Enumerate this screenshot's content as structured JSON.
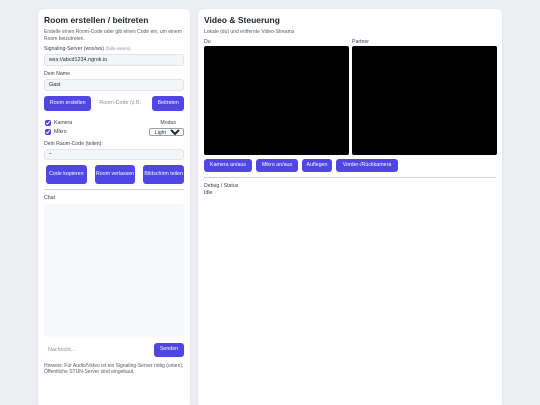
{
  "left": {
    "title": "Room erstellen / beitreten",
    "intro": "Erstelle einen Room-Code oder gib einen Code ein, um einem Room beizutreten.",
    "signaling_label": "Signaling-Server (wss/ws)",
    "signaling_hint": "(falls extern)",
    "signaling_value": "wss://abcd1234.ngrok.io",
    "name_label": "Dein Name",
    "name_value": "Gast",
    "create_room_button": "Room erstellen",
    "room_code_placeholder": "Room-Code (z.B.",
    "join_button": "Beitreten",
    "camera_label": "Kamera",
    "mic_label": "Mikro",
    "mode_label": "Modus",
    "mode_value": "Light",
    "your_code_label": "Dein Raum-Code (teilen):",
    "your_code_value": "–",
    "copy_code_button": "Code kopieren",
    "leave_room_button": "Room verlassen",
    "share_screen_button": "Bildschirm teilen",
    "chat_label": "Chat",
    "message_placeholder": "Nachricht...",
    "send_button": "Senden",
    "note": "Hinweis: Für Audio/Video ist ein Signaling-Server nötig (unten). Öffentliche STUN-Server sind eingebaut."
  },
  "right": {
    "title": "Video & Steuerung",
    "subtitle": "Lokale (du) und entfernte Video-Streams",
    "local_label": "Du",
    "remote_label": "Partner",
    "camera_toggle_button": "Kamera an/aus",
    "mic_toggle_button": "Mikro an/aus",
    "hangup_button": "Auflegen",
    "flip_camera_button": "Vorder-/Rückkamera",
    "debug_label": "Debug / Status",
    "debug_value": "Idle"
  },
  "colors": {
    "accent": "#4f46e5",
    "background": "#eceef2",
    "card": "#ffffff",
    "video": "#000000"
  }
}
